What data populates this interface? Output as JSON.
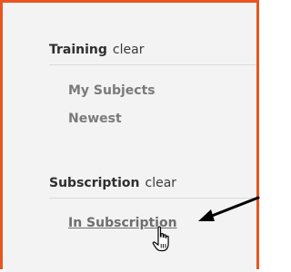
{
  "sections": {
    "training": {
      "title": "Training",
      "clear_label": "clear",
      "items": [
        {
          "label": "My Subjects"
        },
        {
          "label": "Newest"
        }
      ]
    },
    "subscription": {
      "title": "Subscription",
      "clear_label": "clear",
      "items": [
        {
          "label": "In Subscription",
          "hovered": true
        }
      ]
    }
  },
  "colors": {
    "frame_border": "#e8561e",
    "panel_bg": "#f3f3f3",
    "arrow": "#000000"
  },
  "icons": {
    "pointer": "hand-pointer-icon",
    "annotation": "annotation-arrow-icon"
  }
}
